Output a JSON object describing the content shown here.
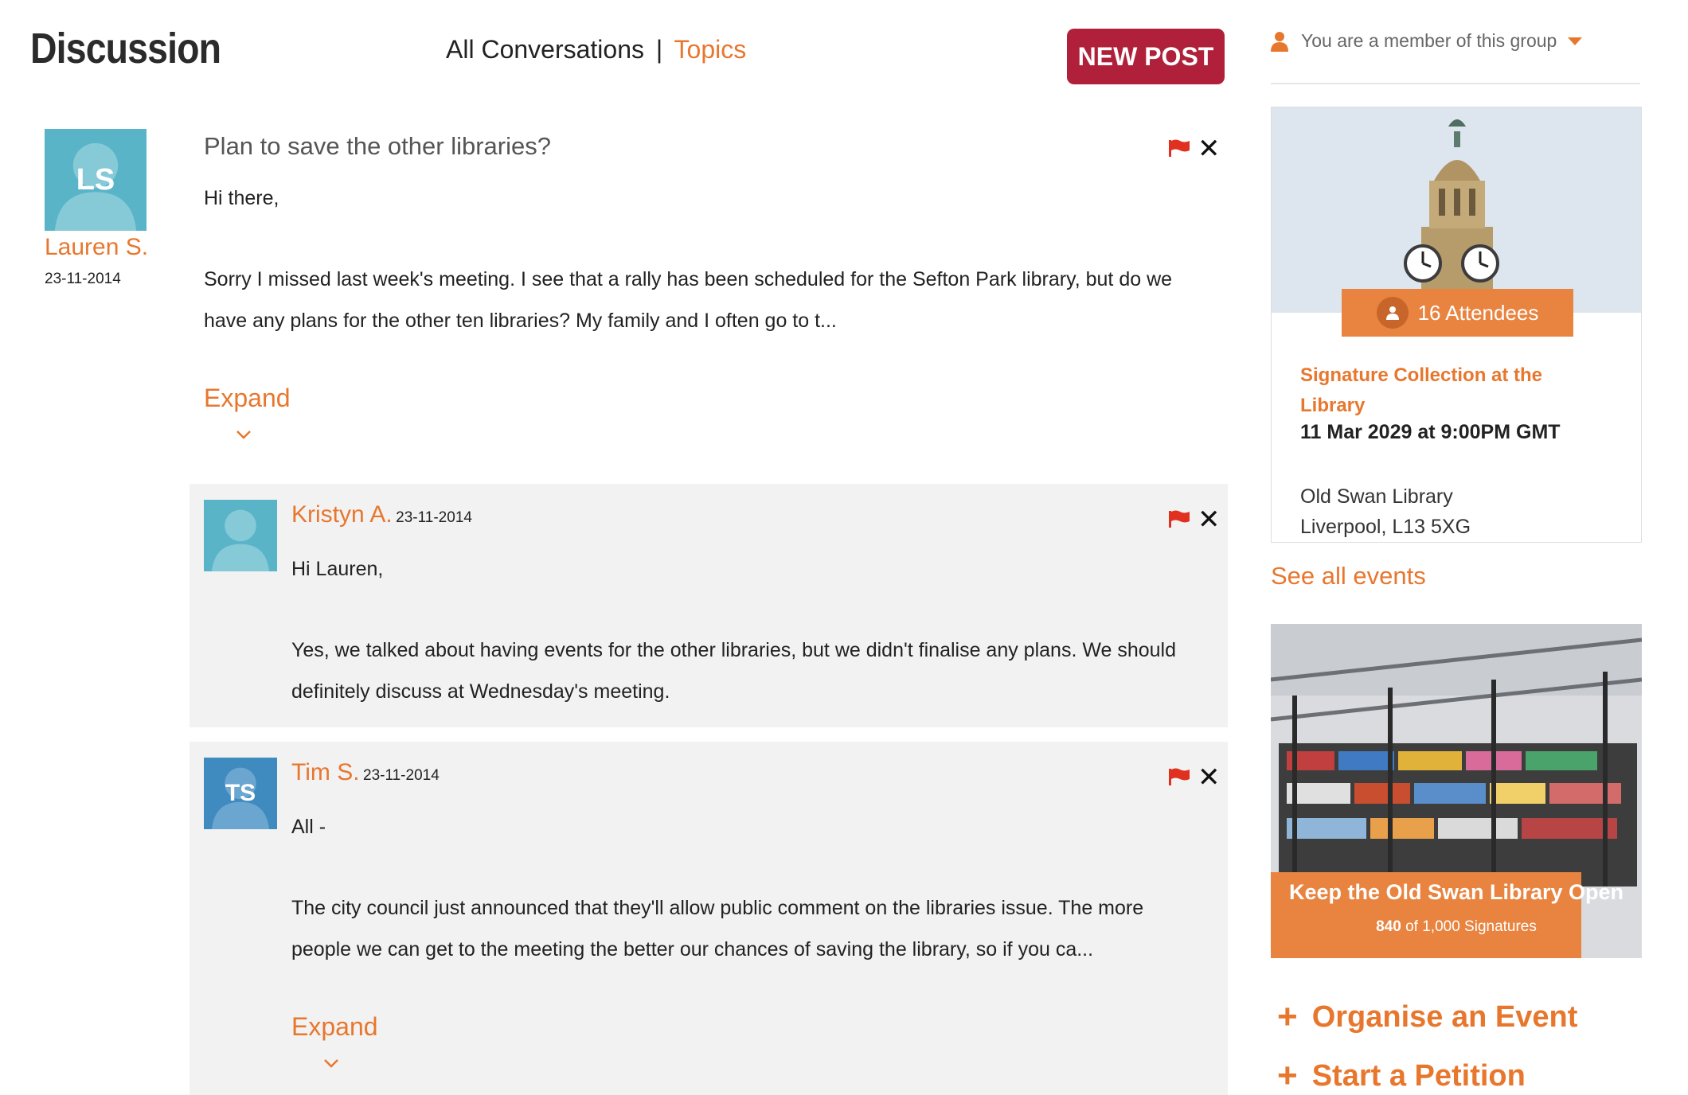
{
  "header": {
    "title": "Discussion",
    "all_conversations": "All Conversations",
    "separator": "|",
    "topics": "Topics",
    "new_post": "NEW POST"
  },
  "main_post": {
    "author_initials": "LS",
    "author": "Lauren S.",
    "date": "23-11-2014",
    "title": "Plan to save the other libraries?",
    "greeting": "Hi there,",
    "body_line1": "Sorry I missed last week's meeting. I see that a rally has been scheduled for the Sefton Park library, but do we",
    "body_line2": "have any plans for the other ten libraries? My family and I often go to t...",
    "expand": "Expand"
  },
  "replies": [
    {
      "author": "Kristyn A.",
      "date": "23-11-2014",
      "greeting": "Hi Lauren,",
      "body_line1": "Yes, we talked about having events for the other libraries, but we didn't finalise any plans. We should",
      "body_line2": "definitely discuss at Wednesday's meeting."
    },
    {
      "author_initials": "TS",
      "author": "Tim S.",
      "date": "23-11-2014",
      "greeting": "All -",
      "body_line1": "The city council just announced that they'll allow public comment on the libraries issue. The more",
      "body_line2": "people we can get to the meeting the better our chances of saving the library, so if you ca...",
      "expand": "Expand"
    }
  ],
  "sidebar": {
    "member_status": "You are a member of this group",
    "event": {
      "attendees": "16 Attendees",
      "title": "Signature Collection at the Library",
      "datetime": "11 Mar 2029 at 9:00PM GMT",
      "address_line1": "Old Swan Library",
      "address_line2": "Liverpool, L13 5XG"
    },
    "see_all_events": "See all events",
    "petition": {
      "title": "Keep the Old Swan Library Open",
      "signed": "840",
      "signatures_rest": "of 1,000 Signatures"
    },
    "actions": {
      "organise_event": "Organise an Event",
      "start_petition": "Start a Petition"
    }
  },
  "colors": {
    "accent": "#e8772e",
    "new_post_button": "#b0203a",
    "flag": "#e03020",
    "avatar_teal": "#5ab4c8",
    "avatar_blue": "#3f8bbf",
    "reply_background": "#f2f2f2"
  }
}
